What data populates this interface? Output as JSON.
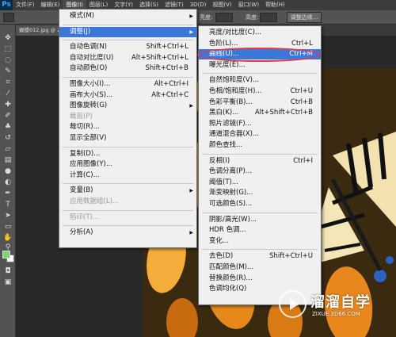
{
  "app": {
    "logo": "Ps"
  },
  "menubar": {
    "items": [
      "文件(F)",
      "编辑(E)",
      "图像(I)",
      "图层(L)",
      "文字(Y)",
      "选择(S)",
      "滤镜(T)",
      "3D(D)",
      "视图(V)",
      "窗口(W)",
      "帮助(H)"
    ]
  },
  "optionsbar": {
    "brightness_label": "亮度:",
    "height_label": "高度:",
    "refine_edge_button": "调整边缘..."
  },
  "document": {
    "tab_label": "蝴蝶012.jpg @ 2..."
  },
  "image_menu": [
    {
      "label": "模式(M)",
      "submenu": true
    },
    {
      "sep": true
    },
    {
      "label": "调整(J)",
      "submenu": true,
      "highlight": true
    },
    {
      "sep": true
    },
    {
      "label": "自动色调(N)",
      "shortcut": "Shift+Ctrl+L"
    },
    {
      "label": "自动对比度(U)",
      "shortcut": "Alt+Shift+Ctrl+L"
    },
    {
      "label": "自动颜色(O)",
      "shortcut": "Shift+Ctrl+B"
    },
    {
      "sep": true
    },
    {
      "label": "图像大小(I)...",
      "shortcut": "Alt+Ctrl+I"
    },
    {
      "label": "画布大小(S)...",
      "shortcut": "Alt+Ctrl+C"
    },
    {
      "label": "图像旋转(G)",
      "submenu": true
    },
    {
      "label": "裁剪(P)",
      "disabled": true
    },
    {
      "label": "裁切(R)..."
    },
    {
      "label": "显示全部(V)"
    },
    {
      "sep": true
    },
    {
      "label": "复制(D)..."
    },
    {
      "label": "应用图像(Y)..."
    },
    {
      "label": "计算(C)..."
    },
    {
      "sep": true
    },
    {
      "label": "变量(B)",
      "submenu": true
    },
    {
      "label": "应用数据组(L)...",
      "disabled": true
    },
    {
      "sep": true
    },
    {
      "label": "陷印(T)...",
      "disabled": true
    },
    {
      "sep": true
    },
    {
      "label": "分析(A)",
      "submenu": true
    }
  ],
  "adjust_menu": [
    {
      "label": "亮度/对比度(C)..."
    },
    {
      "label": "色阶(L)...",
      "shortcut": "Ctrl+L"
    },
    {
      "label": "曲线(U)...",
      "shortcut": "Ctrl+M",
      "highlight": true
    },
    {
      "label": "曝光度(E)..."
    },
    {
      "sep": true
    },
    {
      "label": "自然饱和度(V)..."
    },
    {
      "label": "色相/饱和度(H)...",
      "shortcut": "Ctrl+U"
    },
    {
      "label": "色彩平衡(B)...",
      "shortcut": "Ctrl+B"
    },
    {
      "label": "黑白(K)...",
      "shortcut": "Alt+Shift+Ctrl+B"
    },
    {
      "label": "照片滤镜(F)..."
    },
    {
      "label": "通道混合器(X)..."
    },
    {
      "label": "颜色查找..."
    },
    {
      "sep": true
    },
    {
      "label": "反相(I)",
      "shortcut": "Ctrl+I"
    },
    {
      "label": "色调分离(P)..."
    },
    {
      "label": "阈值(T)..."
    },
    {
      "label": "渐变映射(G)..."
    },
    {
      "label": "可选颜色(S)..."
    },
    {
      "sep": true
    },
    {
      "label": "阴影/高光(W)..."
    },
    {
      "label": "HDR 色调..."
    },
    {
      "label": "变化..."
    },
    {
      "sep": true
    },
    {
      "label": "去色(D)",
      "shortcut": "Shift+Ctrl+U"
    },
    {
      "label": "匹配颜色(M)..."
    },
    {
      "label": "替换颜色(R)..."
    },
    {
      "label": "色调均化(Q)"
    }
  ],
  "watermark": {
    "title": "溜溜自学",
    "url": "ZIXUE.3D66.COM"
  },
  "colors": {
    "highlight": "#3c78d8",
    "annotation_circle": "#e03a4a",
    "menu_bg": "#f0f0f0",
    "chrome": "#535353"
  }
}
